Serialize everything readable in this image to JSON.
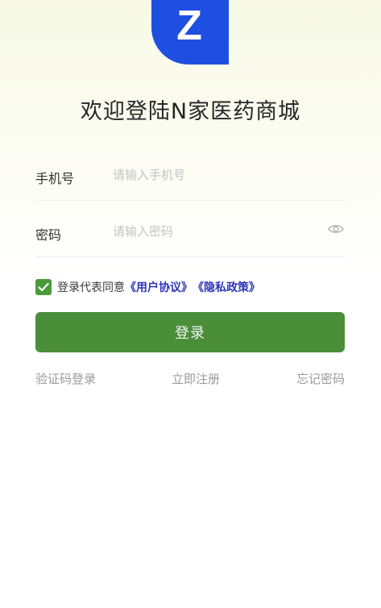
{
  "header": {
    "logo_letter": "Z",
    "logo_color": "#1e4fe0",
    "title": "欢迎登陆N家医药商城"
  },
  "form": {
    "phone_label": "手机号",
    "phone_placeholder": "请输入手机号",
    "phone_value": "",
    "password_label": "密码",
    "password_placeholder": "请输入密码",
    "password_value": "",
    "password_toggle_icon": "eye-icon"
  },
  "agreement": {
    "checked": true,
    "text": "登录代表同意",
    "user_agreement": "《用户协议》",
    "privacy_policy": "《隐私政策》"
  },
  "actions": {
    "login_label": "登录",
    "sms_login": "验证码登录",
    "register": "立即注册",
    "forgot_password": "忘记密码"
  },
  "colors": {
    "primary_green": "#4a8e3a",
    "link_blue": "#2d35b8",
    "logo_blue": "#1e4fe0"
  }
}
